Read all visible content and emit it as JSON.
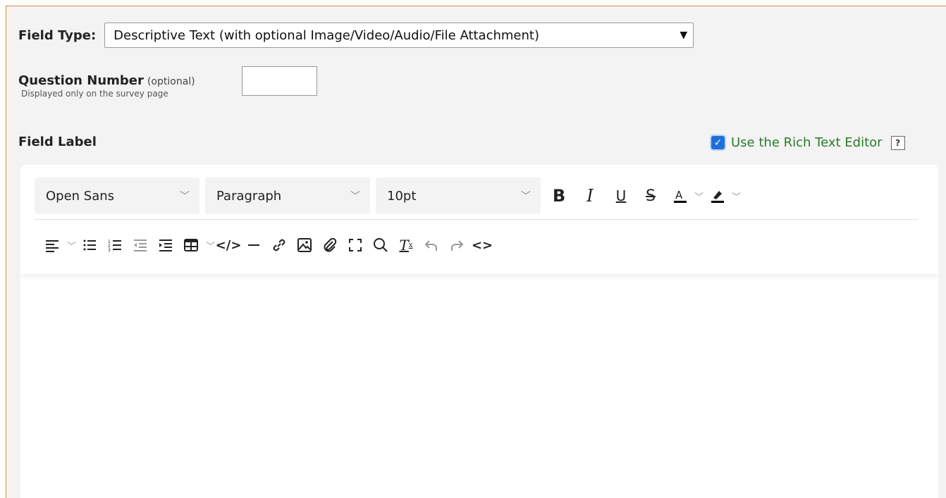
{
  "field_type": {
    "label": "Field Type:",
    "value": "Descriptive Text (with optional Image/Video/Audio/File Attachment)"
  },
  "question_number": {
    "label": "Question Number",
    "optional": "(optional)",
    "sublabel": "Displayed only on the survey page",
    "value": ""
  },
  "field_label": {
    "label": "Field Label",
    "rich_text_label": "Use the Rich Text Editor",
    "rich_text_checked": true,
    "help": "?"
  },
  "editor": {
    "font": "Open Sans",
    "block": "Paragraph",
    "size": "10pt",
    "icons": [
      "bold-icon",
      "italic-icon",
      "underline-icon",
      "strikethrough-icon",
      "text-color-icon",
      "highlight-icon",
      "align-icon",
      "bullet-list-icon",
      "numbered-list-icon",
      "outdent-icon",
      "indent-icon",
      "table-icon",
      "code-icon",
      "horizontal-rule-icon",
      "link-icon",
      "image-icon",
      "attachment-icon",
      "fullscreen-icon",
      "search-icon",
      "clear-format-icon",
      "undo-icon",
      "redo-icon",
      "source-code-icon"
    ],
    "content": ""
  },
  "colors": {
    "accent_border": "#e08a3c",
    "checkbox": "#1e6fd9",
    "rte_text": "#2a7a2a"
  }
}
